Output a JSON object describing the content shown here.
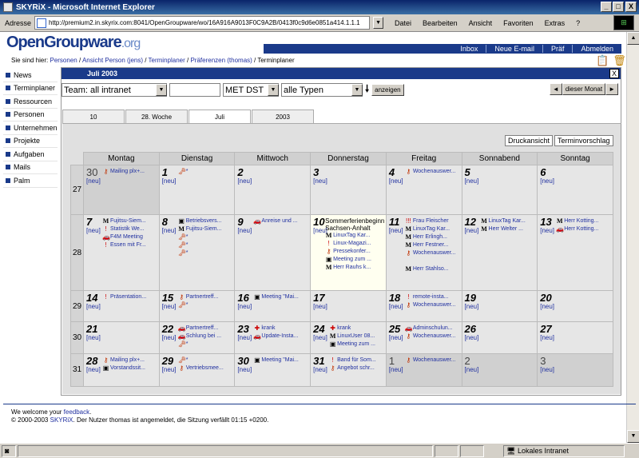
{
  "window": {
    "title": "SKYRiX - Microsoft Internet Explorer",
    "min": "_",
    "max": "□",
    "close": "X"
  },
  "addressbar": {
    "label": "Adresse",
    "url": "http://premium2.in.skyrix.com:8041/OpenGroupware/wo/16A916A9013F0C9A2B/0413f0c9d6e0851a414.1.1.1"
  },
  "menu": [
    "Datei",
    "Bearbeiten",
    "Ansicht",
    "Favoriten",
    "Extras",
    "?"
  ],
  "logo": {
    "main": "OpenGroupware",
    "suffix": ".org"
  },
  "topnav": [
    "Inbox",
    "Neue E-mail",
    "Präf",
    "Abmelden"
  ],
  "breadcrumb": {
    "prefix": "Sie sind hier:",
    "items": [
      "Personen",
      "Ansicht Person (jens)",
      "Terminplaner",
      "Präferenzen (thomas)"
    ],
    "current": "Terminplaner"
  },
  "sidebar": [
    "News",
    "Terminplaner",
    "Ressourcen",
    "Personen",
    "Unternehmen",
    "Projekte",
    "Aufgaben",
    "Mails",
    "Palm"
  ],
  "panel": {
    "title": "Juli 2003",
    "close": "X"
  },
  "toolbar": {
    "team": "Team: all intranet",
    "timezone": "MET DST",
    "types": "alle Typen",
    "show": "anzeigen",
    "prev": "◄",
    "this_month": "dieser Monat",
    "next": "►"
  },
  "tabs": [
    "10",
    "28. Woche",
    "Juli",
    "2003"
  ],
  "calendar": {
    "print": "Druckansicht",
    "proposal": "Terminvorschlag",
    "new_label": "[neu]",
    "weekdays": [
      "Montag",
      "Dienstag",
      "Mittwoch",
      "Donnerstag",
      "Freitag",
      "Sonnabend",
      "Sonntag"
    ],
    "weeks": [
      {
        "no": "27",
        "days": [
          {
            "d": "30",
            "other": true,
            "events": [
              {
                "i": "key",
                "t": "Mailing plx+..."
              }
            ]
          },
          {
            "d": "1",
            "events": [
              {
                "i": "keyr",
                "t": "*"
              }
            ]
          },
          {
            "d": "2",
            "events": []
          },
          {
            "d": "3",
            "events": []
          },
          {
            "d": "4",
            "events": [
              {
                "i": "key",
                "t": "Wochenauswer..."
              }
            ]
          },
          {
            "d": "5",
            "events": []
          },
          {
            "d": "6",
            "events": []
          }
        ]
      },
      {
        "no": "28",
        "days": [
          {
            "d": "7",
            "events": [
              {
                "i": "M",
                "t": "Fujitsu-Siem..."
              },
              {
                "i": "!",
                "t": "Statistik We..."
              },
              {
                "i": "car",
                "t": "F4M Meeting"
              },
              {
                "i": "!",
                "t": "Essen mit Fr..."
              }
            ]
          },
          {
            "d": "8",
            "events": [
              {
                "i": "cam",
                "t": "Betriebsvers..."
              },
              {
                "i": "M",
                "t": "Fujitsu-Siem..."
              },
              {
                "i": "keyr",
                "t": "*"
              },
              {
                "i": "keyr",
                "t": "*"
              },
              {
                "i": "keyr",
                "t": "*"
              }
            ]
          },
          {
            "d": "9",
            "events": [
              {
                "i": "car",
                "t": "Anreise und ..."
              }
            ]
          },
          {
            "d": "10",
            "today": true,
            "holiday": "Sommerferienbeginn Sachsen-Anhalt",
            "events": [
              {
                "i": "M",
                "t": "LinuxTag Kar..."
              },
              {
                "i": "!",
                "t": "Linux-Magazi..."
              },
              {
                "i": "key",
                "t": "Pressekonfer..."
              },
              {
                "i": "cam",
                "t": "Meeting zum ..."
              },
              {
                "i": "M",
                "t": "Herr Rauhs k..."
              }
            ]
          },
          {
            "d": "11",
            "events": [
              {
                "i": "!!!",
                "t": "Frau Fleischer"
              },
              {
                "i": "M",
                "t": "LinuxTag Kar..."
              },
              {
                "i": "M",
                "t": "Herr Erlingh..."
              },
              {
                "i": "M",
                "t": "Herr Festner..."
              },
              {
                "i": "key",
                "t": "Wochenauswer..."
              },
              {
                "i": "",
                "t": ""
              },
              {
                "i": "M",
                "t": "Herr Stahlso..."
              }
            ]
          },
          {
            "d": "12",
            "events": [
              {
                "i": "M",
                "t": "LinuxTag Kar..."
              },
              {
                "i": "M",
                "t": "Herr Welter ..."
              }
            ]
          },
          {
            "d": "13",
            "events": [
              {
                "i": "M",
                "t": "Herr Kotting..."
              },
              {
                "i": "car",
                "t": "Herr Kotting..."
              }
            ]
          }
        ]
      },
      {
        "no": "29",
        "days": [
          {
            "d": "14",
            "events": [
              {
                "i": "!",
                "t": "Präsentation..."
              }
            ]
          },
          {
            "d": "15",
            "events": [
              {
                "i": "key",
                "t": "Partnertreff..."
              },
              {
                "i": "keyr",
                "t": "*"
              }
            ]
          },
          {
            "d": "16",
            "events": [
              {
                "i": "cam",
                "t": "Meeting \"Mai..."
              }
            ]
          },
          {
            "d": "17",
            "events": []
          },
          {
            "d": "18",
            "events": [
              {
                "i": "!",
                "t": "remote-insta..."
              },
              {
                "i": "key",
                "t": "Wochenauswer..."
              }
            ]
          },
          {
            "d": "19",
            "events": []
          },
          {
            "d": "20",
            "events": []
          }
        ]
      },
      {
        "no": "30",
        "days": [
          {
            "d": "21",
            "events": []
          },
          {
            "d": "22",
            "events": [
              {
                "i": "car",
                "t": "Partnertreff..."
              },
              {
                "i": "car",
                "t": "Schlung bei ..."
              },
              {
                "i": "keyr",
                "t": "*"
              }
            ]
          },
          {
            "d": "23",
            "events": [
              {
                "i": "plus",
                "t": "krank"
              },
              {
                "i": "car",
                "t": "Update-Insta..."
              }
            ]
          },
          {
            "d": "24",
            "events": [
              {
                "i": "plus",
                "t": "krank"
              },
              {
                "i": "M",
                "t": "LinuxUser 08..."
              },
              {
                "i": "cam",
                "t": "Meeting zum ..."
              }
            ]
          },
          {
            "d": "25",
            "events": [
              {
                "i": "car",
                "t": "Adminschulun..."
              },
              {
                "i": "key",
                "t": "Wochenauswer..."
              }
            ]
          },
          {
            "d": "26",
            "events": []
          },
          {
            "d": "27",
            "events": []
          }
        ]
      },
      {
        "no": "31",
        "days": [
          {
            "d": "28",
            "events": [
              {
                "i": "key",
                "t": "Mailing plx+..."
              },
              {
                "i": "cam",
                "t": "Vorstandssit..."
              }
            ]
          },
          {
            "d": "29",
            "events": [
              {
                "i": "keyr",
                "t": "*"
              },
              {
                "i": "key",
                "t": "Vertriebsmee..."
              }
            ]
          },
          {
            "d": "30",
            "events": [
              {
                "i": "cam",
                "t": "Meeting \"Mai..."
              }
            ]
          },
          {
            "d": "31",
            "events": [
              {
                "i": "!",
                "t": "Band für Som..."
              },
              {
                "i": "key",
                "t": "Angebot schr..."
              }
            ]
          },
          {
            "d": "1",
            "other": true,
            "events": [
              {
                "i": "key",
                "t": "Wochenauswer..."
              }
            ]
          },
          {
            "d": "2",
            "other": true,
            "events": []
          },
          {
            "d": "3",
            "other": true,
            "events": []
          }
        ]
      }
    ]
  },
  "footer": {
    "line1_a": "We welcome your ",
    "line1_link": "feedback",
    "line1_b": ".",
    "line2_a": "© 2000-2003 ",
    "line2_link": "SKYRiX",
    "line2_b": ". Der Nutzer thomas ist angemeldet, die Sitzung verfällt 01:15 +0200."
  },
  "statusbar": {
    "zone": "Lokales Intranet"
  },
  "colors": {
    "brand": "#1a3a8a",
    "link": "#2030a0",
    "today": "#fffff0"
  }
}
